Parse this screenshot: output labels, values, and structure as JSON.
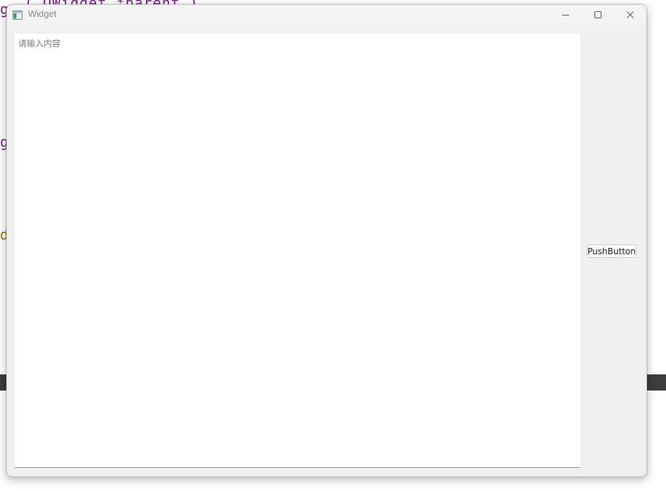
{
  "background": {
    "code_fragments": [
      "g",
      "g",
      "d"
    ],
    "top_fragment": "( QWidget  *parent )"
  },
  "window": {
    "title": "Widget",
    "icon": "app-window-icon",
    "controls": {
      "minimize_icon": "minimize-icon",
      "maximize_icon": "maximize-icon",
      "close_icon": "close-icon"
    }
  },
  "text_edit": {
    "placeholder": "请输入内容",
    "value": ""
  },
  "push_button": {
    "label": "PushButton"
  },
  "colors": {
    "window_bg": "#f0f0f0",
    "title_text": "#8a8a8a",
    "placeholder_text": "#7a7a7a",
    "code_purple": "#7a1d8a",
    "code_olive": "#808000",
    "dark_strip": "#3c3c3c"
  }
}
